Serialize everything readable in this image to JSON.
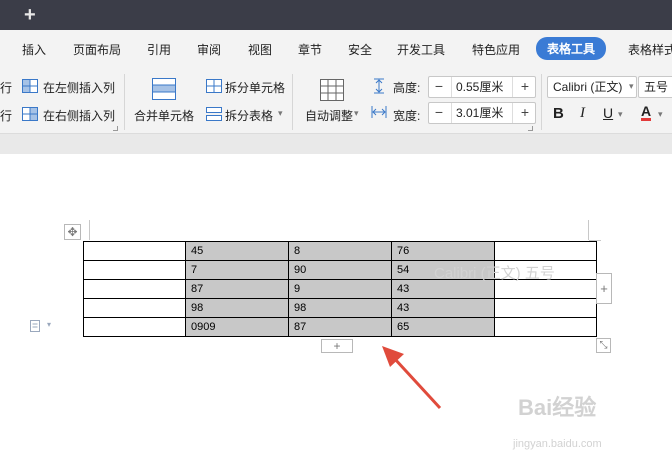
{
  "titlebar": {
    "new_tab_symbol": "+"
  },
  "menu": {
    "items": [
      "插入",
      "页面布局",
      "引用",
      "审阅",
      "视图",
      "章节",
      "安全",
      "开发工具",
      "特色应用",
      "表格工具",
      "表格样式"
    ],
    "active": "表格工具"
  },
  "ribbon": {
    "insert_row_above_partial": "行",
    "insert_row_below_partial": "行",
    "insert_col_left": "在左侧插入列",
    "insert_col_right": "在右侧插入列",
    "merge_cells": "合并单元格",
    "split_cells": "拆分单元格",
    "split_table": "拆分表格",
    "auto_fit": "自动调整",
    "height_label": "高度:",
    "height_value": "0.55厘米",
    "width_label": "宽度:",
    "width_value": "3.01厘米",
    "font_name": "Calibri (正文)",
    "font_size": "五号",
    "bold": "B",
    "italic": "I",
    "underline": "U",
    "font_color": "A",
    "spin_minus": "−",
    "spin_plus": "+"
  },
  "table": {
    "rows": [
      [
        "",
        "45",
        "8",
        "76",
        ""
      ],
      [
        "",
        "7",
        "90",
        "54",
        ""
      ],
      [
        "",
        "87",
        "9",
        "43",
        ""
      ],
      [
        "",
        "98",
        "98",
        "43",
        ""
      ],
      [
        "",
        "0909",
        "87",
        "65",
        ""
      ]
    ]
  },
  "handles": {
    "add_row": "+",
    "add_col": "+"
  },
  "watermark": {
    "brand": "Bai经验",
    "url": "jingyan.baidu.com"
  },
  "colors": {
    "titlebar": "#3b3d48",
    "accent": "#3a7bd5",
    "selected_cell": "#c8c8c8",
    "arrow": "#e04b3c"
  }
}
